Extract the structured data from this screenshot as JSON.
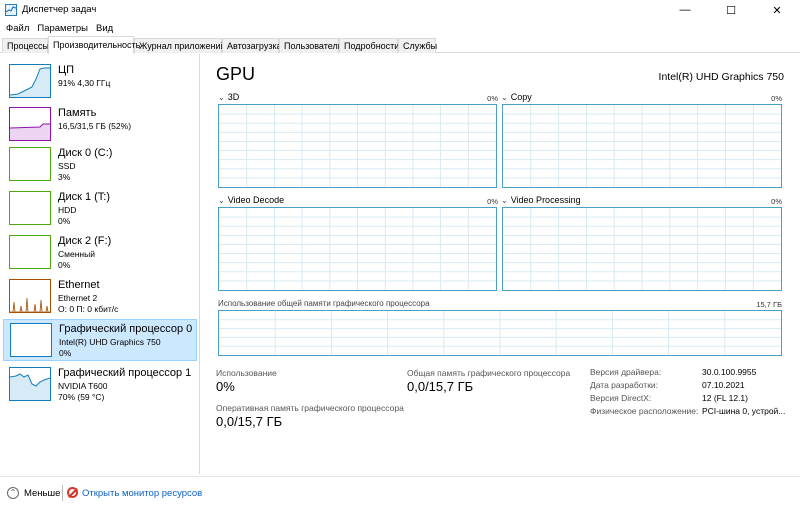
{
  "window": {
    "title": "Диспетчер задач",
    "controls": {
      "minimize": "—",
      "maximize": "☐",
      "close": "✕"
    }
  },
  "menu": [
    "Файл",
    "Параметры",
    "Вид"
  ],
  "tabs": [
    "Процессы",
    "Производительность",
    "Журнал приложений",
    "Автозагрузка",
    "Пользователи",
    "Подробности",
    "Службы"
  ],
  "active_tab": "Производительность",
  "sidebar": {
    "items": [
      {
        "name": "ЦП",
        "line1": "91% 4,30 ГГц",
        "line2": "",
        "color": "#117dbb",
        "level": 0.91
      },
      {
        "name": "Память",
        "line1": "16,5/31,5 ГБ (52%)",
        "line2": "",
        "color": "#8b12ae",
        "level": 0.52
      },
      {
        "name": "Диск 0 (C:)",
        "line1": "SSD",
        "line2": "3%",
        "color": "#4da60c",
        "level": 0.03
      },
      {
        "name": "Диск 1 (T:)",
        "line1": "HDD",
        "line2": "0%",
        "color": "#4da60c",
        "level": 0.0
      },
      {
        "name": "Диск 2 (F:)",
        "line1": "Сменный",
        "line2": "0%",
        "color": "#4da60c",
        "level": 0.0
      },
      {
        "name": "Ethernet",
        "line1": "Ethernet 2",
        "line2": "О: 0 П: 0 кбит/с",
        "color": "#a74f01",
        "level": 0.0
      },
      {
        "name": "Графический процессор 0",
        "line1": "Intel(R) UHD Graphics 750",
        "line2": "0%",
        "color": "#117dbb",
        "level": 0.0
      },
      {
        "name": "Графический процессор 1",
        "line1": "NVIDIA T600",
        "line2": "70% (59 °C)",
        "color": "#117dbb",
        "level": 0.7
      }
    ]
  },
  "main": {
    "title": "GPU",
    "model": "Intel(R) UHD Graphics 750",
    "graphs": [
      {
        "label": "3D",
        "pct": "0%"
      },
      {
        "label": "Copy",
        "pct": "0%"
      },
      {
        "label": "Video Decode",
        "pct": "0%"
      },
      {
        "label": "Video Processing",
        "pct": "0%"
      }
    ],
    "shared_memory": {
      "label": "Использование общей памяти графического процессора",
      "max": "15,7 ГБ"
    },
    "stats": {
      "usage_label": "Использование",
      "usage_value": "0%",
      "shared_label": "Общая память графического процессора",
      "shared_value": "0,0/15,7 ГБ",
      "dedicated_label": "Оперативная память графического процессора",
      "dedicated_value": "0,0/15,7 ГБ"
    },
    "details": [
      {
        "key": "Версия драйвера:",
        "value": "30.0.100.9955"
      },
      {
        "key": "Дата разработки:",
        "value": "07.10.2021"
      },
      {
        "key": "Версия DirectX:",
        "value": "12 (FL 12.1)"
      },
      {
        "key": "Физическое расположение:",
        "value": "PCI-шина 0, устрой..."
      }
    ]
  },
  "footer": {
    "less_label": "Меньше",
    "monitor_label": "Открыть монитор ресурсов",
    "less_icon": "chevron-up-icon",
    "monitor_icon": "resource-monitor-icon"
  },
  "colors": {
    "graph_border": "#4a9fc5",
    "grid": "#d9eaf2",
    "selection": "#cce8ff",
    "link": "#0a62c9"
  }
}
